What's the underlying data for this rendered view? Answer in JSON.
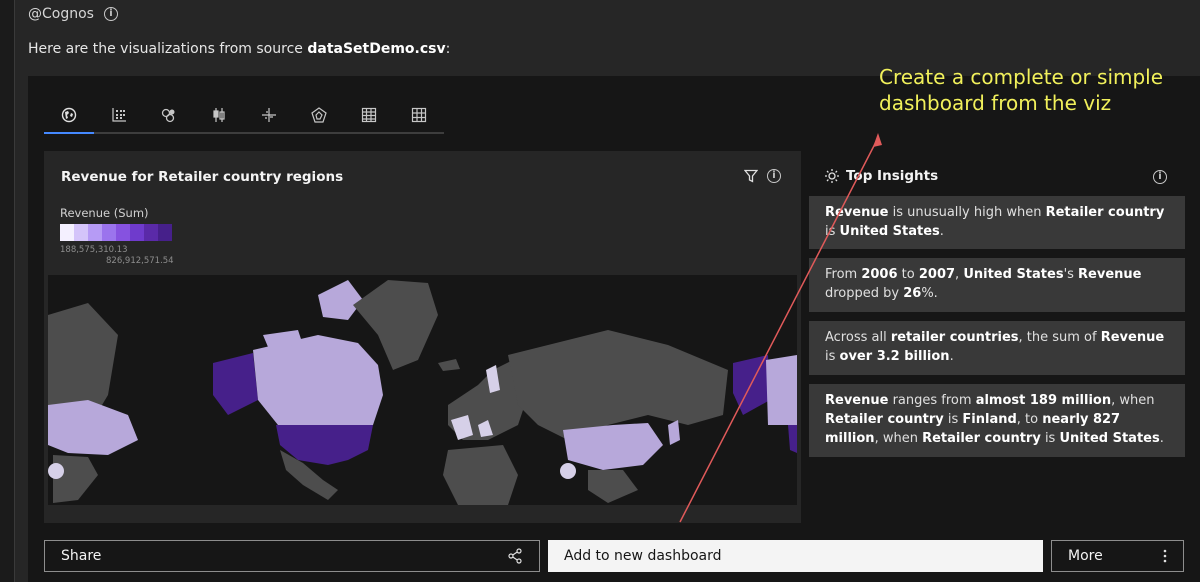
{
  "header": {
    "source_label": "@Cognos"
  },
  "intro": {
    "prefix": "Here are the visualizations from source ",
    "filename": "dataSetDemo.csv",
    "suffix": ":"
  },
  "tabs": [
    {
      "icon": "globe-icon",
      "active": true
    },
    {
      "icon": "scatter-icon"
    },
    {
      "icon": "bubble-icon"
    },
    {
      "icon": "boxplot-icon"
    },
    {
      "icon": "crosshair-icon"
    },
    {
      "icon": "radar-icon"
    },
    {
      "icon": "crosstab-icon"
    },
    {
      "icon": "table-icon"
    }
  ],
  "map_card": {
    "title": "Revenue for Retailer country regions",
    "legend_title": "Revenue (Sum)",
    "legend_min": "188,575,310.13",
    "legend_max": "826,912,571.54",
    "legend_colors": [
      "#f4f0ff",
      "#d4c4fa",
      "#b69bf5",
      "#9b74ed",
      "#8652e0",
      "#6f3bcc",
      "#5a2aa8",
      "#46208a"
    ]
  },
  "insights": {
    "title": "Top Insights",
    "items": [
      {
        "parts": [
          {
            "t": "Revenue",
            "b": true
          },
          {
            "t": " is unusually high when "
          },
          {
            "t": "Retailer country",
            "b": true
          },
          {
            "t": " is "
          },
          {
            "t": "United States",
            "b": true
          },
          {
            "t": "."
          }
        ]
      },
      {
        "parts": [
          {
            "t": "From "
          },
          {
            "t": "2006",
            "b": true
          },
          {
            "t": " to "
          },
          {
            "t": "2007",
            "b": true
          },
          {
            "t": ", "
          },
          {
            "t": "United States",
            "b": true
          },
          {
            "t": "'s "
          },
          {
            "t": "Revenue",
            "b": true
          },
          {
            "t": " dropped by "
          },
          {
            "t": "26",
            "b": true
          },
          {
            "t": "%."
          }
        ]
      },
      {
        "parts": [
          {
            "t": "Across all "
          },
          {
            "t": "retailer countries",
            "b": true
          },
          {
            "t": ", the sum of "
          },
          {
            "t": "Revenue",
            "b": true
          },
          {
            "t": " is "
          },
          {
            "t": "over 3.2 billion",
            "b": true
          },
          {
            "t": "."
          }
        ]
      },
      {
        "parts": [
          {
            "t": "Revenue",
            "b": true
          },
          {
            "t": " ranges from "
          },
          {
            "t": "almost 189 million",
            "b": true
          },
          {
            "t": ", when "
          },
          {
            "t": "Retailer country",
            "b": true
          },
          {
            "t": " is "
          },
          {
            "t": "Finland",
            "b": true
          },
          {
            "t": ", to "
          },
          {
            "t": "nearly 827 million",
            "b": true
          },
          {
            "t": ", when "
          },
          {
            "t": "Retailer country",
            "b": true
          },
          {
            "t": " is "
          },
          {
            "t": "United States",
            "b": true
          },
          {
            "t": "."
          }
        ]
      }
    ]
  },
  "buttons": {
    "share": "Share",
    "add_dashboard": "Add to new dashboard",
    "more": "More"
  },
  "annotation": "Create a complete or simple dashboard from the viz",
  "colors": {
    "accent": "#4589ff",
    "annotation": "#f1f05b",
    "land_default": "#4d4d4d",
    "us_fill": "#46208a"
  }
}
